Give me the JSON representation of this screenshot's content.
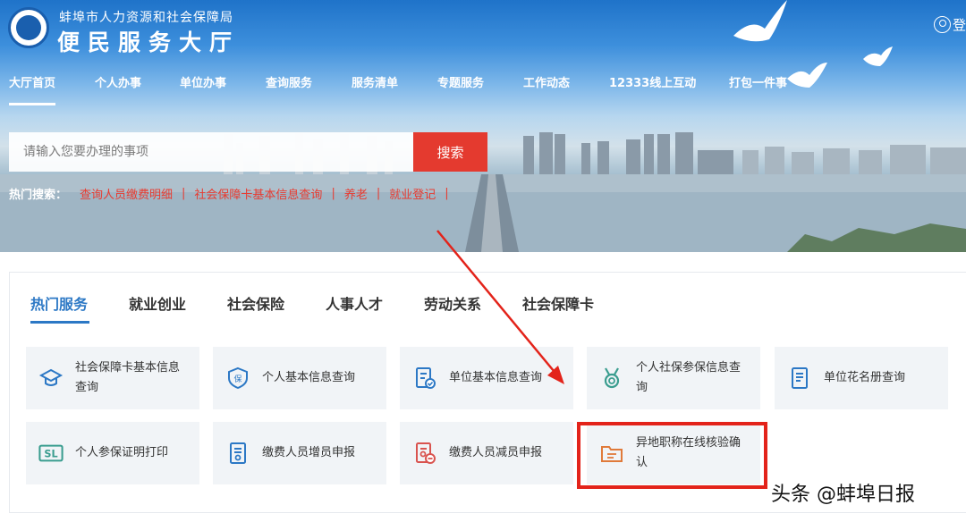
{
  "header": {
    "org_name": "蚌埠市人力资源和社会保障局",
    "hall_name": "便民服务大厅",
    "login_label": "登"
  },
  "nav": {
    "items": [
      "大厅首页",
      "个人办事",
      "单位办事",
      "查询服务",
      "服务清单",
      "专题服务",
      "工作动态",
      "12333线上互动",
      "打包一件事"
    ],
    "active": "大厅首页"
  },
  "search": {
    "placeholder": "请输入您要办理的事项",
    "button_label": "搜索",
    "hot_label": "热门搜索：",
    "hot_links": [
      "查询人员缴费明细",
      "社会保障卡基本信息查询",
      "养老",
      "就业登记"
    ]
  },
  "tabs": {
    "items": [
      "热门服务",
      "就业创业",
      "社会保险",
      "人事人才",
      "劳动关系",
      "社会保障卡"
    ],
    "active": "热门服务"
  },
  "services": [
    {
      "label": "社会保障卡基本信息查询",
      "icon": "graduation-cap-icon"
    },
    {
      "label": "个人基本信息查询",
      "icon": "shield-icon"
    },
    {
      "label": "单位基本信息查询",
      "icon": "document-check-icon"
    },
    {
      "label": "个人社保参保信息查询",
      "icon": "medal-icon"
    },
    {
      "label": "单位花名册查询",
      "icon": "roster-icon"
    },
    {
      "label": "个人参保证明打印",
      "icon": "sl-badge-icon"
    },
    {
      "label": "缴费人员增员申报",
      "icon": "document-add-icon"
    },
    {
      "label": "缴费人员减员申报",
      "icon": "document-remove-icon"
    },
    {
      "label": "异地职称在线核验确认",
      "icon": "folder-icon"
    }
  ],
  "colors": {
    "accent_blue": "#2c78c5",
    "search_red": "#e43a2f",
    "highlight_red": "#e3231a",
    "card_bg": "#f1f4f7"
  },
  "watermark": "头条 @蚌埠日报"
}
